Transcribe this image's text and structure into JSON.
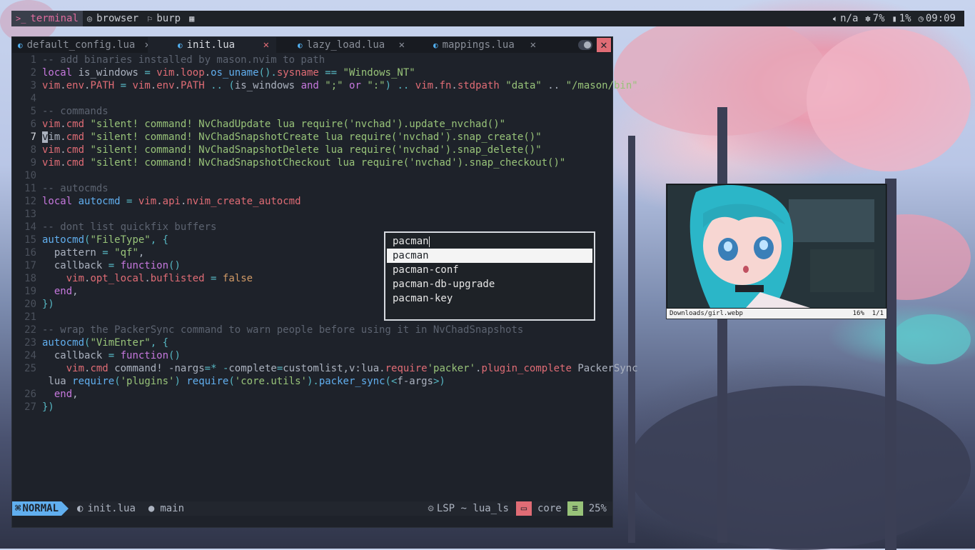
{
  "topbar": {
    "workspaces": [
      {
        "label": "terminal",
        "icon": "terminal-icon",
        "active": true
      },
      {
        "label": "browser",
        "icon": "chrome-icon",
        "active": false
      },
      {
        "label": "burp",
        "icon": "flag-icon",
        "active": false
      },
      {
        "label": "",
        "icon": "grid-icon",
        "active": false
      }
    ],
    "volume": "n/a",
    "cpu": "7%",
    "memory": "1%",
    "clock": "09:09"
  },
  "editor": {
    "tabs": [
      {
        "label": "default_config.lua",
        "active": false
      },
      {
        "label": "init.lua",
        "active": true
      },
      {
        "label": "lazy_load.lua",
        "active": false
      },
      {
        "label": "mappings.lua",
        "active": false
      }
    ],
    "code_lines": [
      {
        "n": "1",
        "t": "-- add binaries installed by mason.nvim to path"
      },
      {
        "n": "2",
        "t": "local is_windows = vim.loop.os_uname().sysname == \"Windows_NT\""
      },
      {
        "n": "3",
        "t": "vim.env.PATH = vim.env.PATH .. (is_windows and \";\" or \":\") .. vim.fn.stdpath \"data\" .. \"/mason/bin\""
      },
      {
        "n": "4",
        "t": ""
      },
      {
        "n": "5",
        "t": "-- commands"
      },
      {
        "n": "6",
        "t": "vim.cmd \"silent! command! NvChadUpdate lua require('nvchad').update_nvchad()\""
      },
      {
        "n": "7",
        "t": "vim.cmd \"silent! command! NvChadSnapshotCreate lua require('nvchad').snap_create()\""
      },
      {
        "n": "8",
        "t": "vim.cmd \"silent! command! NvChadSnapshotDelete lua require('nvchad').snap_delete()\""
      },
      {
        "n": "9",
        "t": "vim.cmd \"silent! command! NvChadSnapshotCheckout lua require('nvchad').snap_checkout()\""
      },
      {
        "n": "10",
        "t": ""
      },
      {
        "n": "11",
        "t": "-- autocmds"
      },
      {
        "n": "12",
        "t": "local autocmd = vim.api.nvim_create_autocmd"
      },
      {
        "n": "13",
        "t": ""
      },
      {
        "n": "14",
        "t": "-- dont list quickfix buffers"
      },
      {
        "n": "15",
        "t": "autocmd(\"FileType\", {"
      },
      {
        "n": "16",
        "t": "  pattern = \"qf\","
      },
      {
        "n": "17",
        "t": "  callback = function()"
      },
      {
        "n": "18",
        "t": "    vim.opt_local.buflisted = false"
      },
      {
        "n": "19",
        "t": "  end,"
      },
      {
        "n": "20",
        "t": "})"
      },
      {
        "n": "21",
        "t": ""
      },
      {
        "n": "22",
        "t": "-- wrap the PackerSync command to warn people before using it in NvChadSnapshots"
      },
      {
        "n": "23",
        "t": "autocmd(\"VimEnter\", {"
      },
      {
        "n": "24",
        "t": "  callback = function()"
      },
      {
        "n": "25",
        "t": "    vim.cmd \"command! -nargs=* -complete=customlist,v:lua.require'packer'.plugin_complete PackerSync"
      },
      {
        "n": "",
        "t": " lua require('plugins') require('core.utils').packer_sync(<f-args>)\""
      },
      {
        "n": "26",
        "t": "  end,"
      },
      {
        "n": "27",
        "t": "})"
      }
    ],
    "current_line": "7",
    "statusline": {
      "mode": "NORMAL",
      "file": "init.lua",
      "branch": "main",
      "lsp": "LSP ~ lua_ls",
      "cwd": "core",
      "progress": "25%"
    }
  },
  "launcher": {
    "query": "pacman",
    "options": [
      "pacman",
      "pacman-conf",
      "pacman-db-upgrade",
      "pacman-key"
    ],
    "selected_index": 0
  },
  "viewer": {
    "filename": "Downloads/girl.webp",
    "zoom": "16%",
    "index": "1/1"
  },
  "colors": {
    "accent_blue": "#61afef",
    "accent_red": "#e06c75",
    "accent_green": "#98c379",
    "accent_pink": "#e06c9f"
  }
}
